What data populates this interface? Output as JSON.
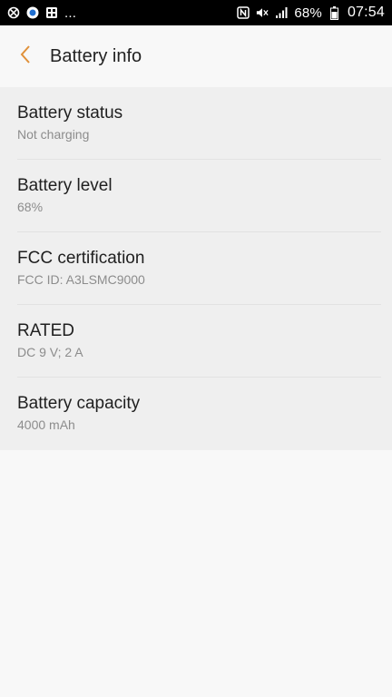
{
  "status_bar": {
    "notification_dots": "...",
    "battery_percent": "68%",
    "time": "07:54"
  },
  "app_bar": {
    "title": "Battery info",
    "back_icon": "chevron-left-icon",
    "accent_color": "#e0913a"
  },
  "items": [
    {
      "title": "Battery status",
      "value": "Not charging"
    },
    {
      "title": "Battery level",
      "value": "68%"
    },
    {
      "title": "FCC certification",
      "value": "FCC ID: A3LSMC9000"
    },
    {
      "title": "RATED",
      "value": "DC 9 V; 2 A"
    },
    {
      "title": "Battery capacity",
      "value": "4000 mAh"
    }
  ]
}
